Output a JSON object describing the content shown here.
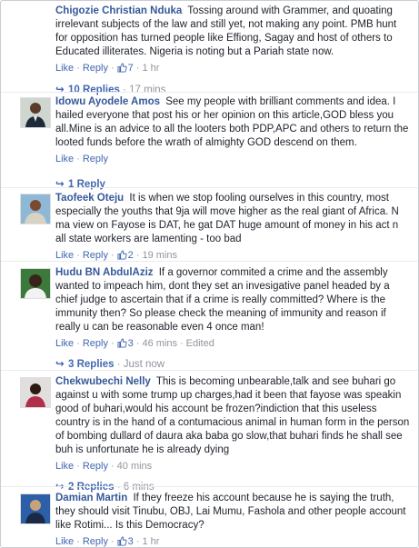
{
  "actions": {
    "like": "Like",
    "reply": "Reply",
    "sep": "·"
  },
  "comments": [
    {
      "author": "Chigozie Christian Nduka",
      "text": "Tossing around with Grammer, and quoating irrelevant subjects of the law and still yet, not making any point. PMB hunt for opposition has turned people like Effiong, Sagay and host of others to Educated illiterates. Nigeria is noting but a Pariah state now.",
      "likes": "7",
      "time": "1 hr",
      "replies": "10 Replies",
      "replies_time": "17 mins"
    },
    {
      "author": "Idowu Ayodele Amos",
      "text": "See my people with brilliant comments and idea. I hailed everyone that post his or her opinion on this article,GOD bless you all.Mine is an advice to all the looters both PDP,APC and others to return the looted funds before the wrath of almighty GOD descend on them.",
      "replies": "1 Reply",
      "replies_time": ""
    },
    {
      "author": "Taofeek Oteju",
      "text": "It is when we stop fooling ourselves in this country, most especially the youths that 9ja will move higher as the real giant of Africa. N ma view on Fayose is DAT, he gat DAT huge amount of money in his act n all state workers are lamenting - too bad",
      "likes": "2",
      "time": "19 mins"
    },
    {
      "author": "Hudu BN AbdulAziz",
      "text": "If a governor commited a crime and the assembly wanted to impeach him, dont they set an invesigative panel headed by a chief judge to ascertain that if a crime is really committed? Where is the immunity then? So please check the meaning of immunity and reason if really u can be reasonable even 4 once man!",
      "likes": "3",
      "time": "46 mins",
      "edited": "Edited",
      "replies": "3 Replies",
      "replies_time": "Just now"
    },
    {
      "author": "Chekwubechi Nelly",
      "text": "This is becoming unbearable,talk and see buhari go against u with some trump up charges,had it been that fayose was speakin good of buhari,would his account be frozen?indiction that this useless country is in the hand of a contumacious animal in human form in the person of bombing dullard of daura aka baba go slow,that buhari finds he shall see buh is unfortunate he is already dying",
      "time": "40 mins",
      "replies": "2 Replies",
      "replies_time": "6 mins"
    },
    {
      "author": "Damian Martin",
      "text": "If they freeze his account because he is saying the truth, they should visit Tinubu, OBJ, Lai Mumu, Fashola and other people account like Rotimi... Is this Democracy?",
      "likes": "3",
      "time": "1 hr"
    }
  ],
  "colors": {
    "link": "#4267b2",
    "author": "#365899",
    "meta": "#90949c",
    "text": "#1d2129"
  }
}
